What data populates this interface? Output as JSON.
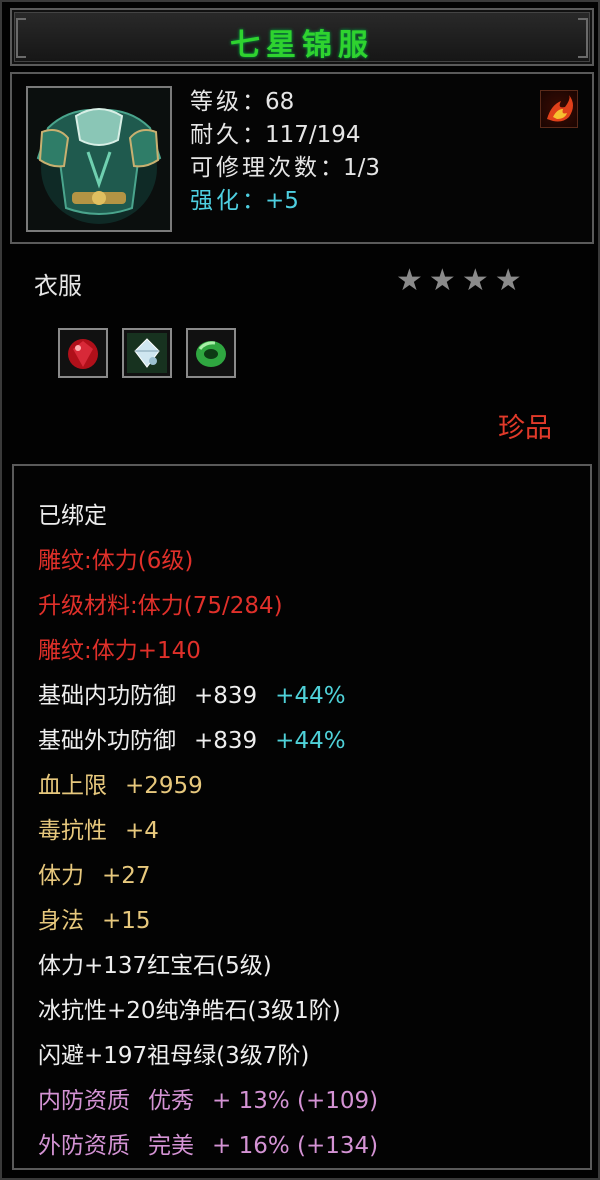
{
  "item": {
    "name": "七星锦服",
    "level": {
      "label": "等级",
      "value": "68"
    },
    "durability": {
      "label": "耐久",
      "value": "117/194"
    },
    "repairs": {
      "label": "可修理次数",
      "value": "1/3"
    },
    "enhance": {
      "label": "强化",
      "value": "+5"
    },
    "type": "衣服",
    "stars_total": 4,
    "quality": "珍品",
    "gems": [
      "ruby-gem-icon",
      "diamond-gem-icon",
      "jade-gem-icon"
    ]
  },
  "attributes": {
    "bound": "已绑定",
    "engrave_level": "雕纹:体力(6级)",
    "upgrade_material": "升级材料:体力(75/284)",
    "engrave_bonus": "雕纹:体力+140",
    "base_inner_def": {
      "label": "基础内功防御",
      "value": "+839",
      "pct": "+44%"
    },
    "base_outer_def": {
      "label": "基础外功防御",
      "value": "+839",
      "pct": "+44%"
    },
    "hp_max": {
      "label": "血上限",
      "value": "+2959"
    },
    "poison_res": {
      "label": "毒抗性",
      "value": "+4"
    },
    "stamina": {
      "label": "体力",
      "value": "+27"
    },
    "agility": {
      "label": "身法",
      "value": "+15"
    },
    "gem1": "体力+137红宝石(5级)",
    "gem2": "冰抗性+20纯净皓石(3级1阶)",
    "gem3": "闪避+197祖母绿(3级7阶)",
    "inner_quality": {
      "label": "内防资质",
      "grade": "优秀",
      "value": "+ 13% (+109)"
    },
    "outer_quality": {
      "label": "外防资质",
      "grade": "完美",
      "value": "+ 16% (+134)"
    }
  },
  "colors": {
    "title": "#2fd32f",
    "red": "#e0302a",
    "gold": "#e7c87d",
    "cyan": "#4fd1d8",
    "pink": "#d493d4"
  }
}
